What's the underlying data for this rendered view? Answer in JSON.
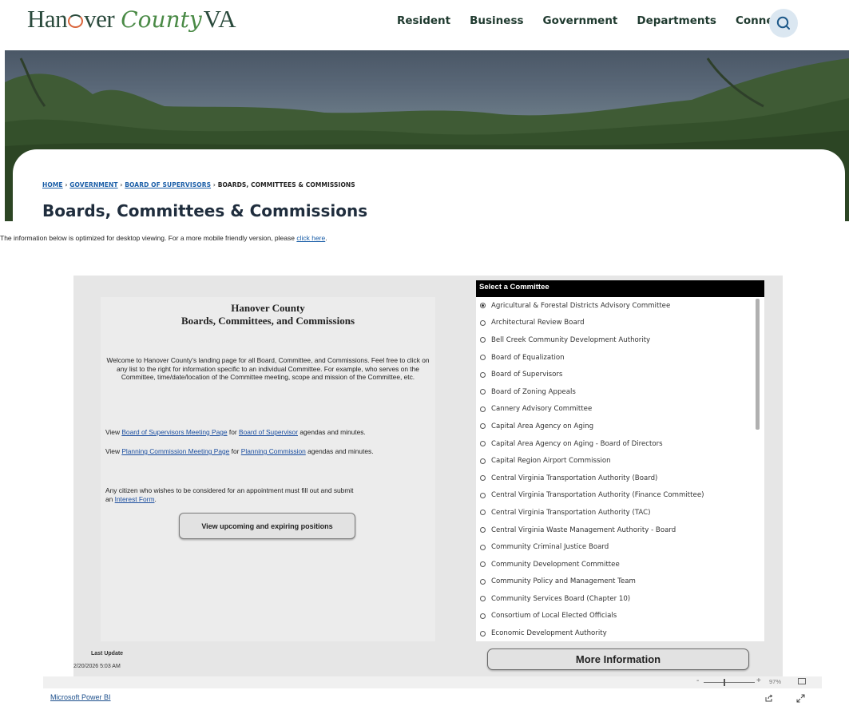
{
  "header": {
    "logo": {
      "part1": "Han",
      "part2": "ver",
      "part3": "County",
      "part4": "VA"
    },
    "nav": [
      "Resident",
      "Business",
      "Government",
      "Departments",
      "Connect"
    ]
  },
  "breadcrumb": {
    "home": "HOME",
    "government": "GOVERNMENT",
    "board": "BOARD OF SUPERVISORS",
    "current": "BOARDS, COMMITTEES & COMMISSIONS",
    "separator": "›"
  },
  "page": {
    "title": "Boards, Committees & Commissions",
    "intro_text": "The information below is optimized for desktop viewing.  For a more mobile friendly version, please ",
    "intro_link": "click here",
    "intro_end": "."
  },
  "report": {
    "left": {
      "title1": "Hanover County",
      "title2": "Boards, Committees, and Commissions",
      "welcome": "Welcome to Hanover County's landing page for all Board, Committee, and Commissions.  Feel free to click on any list to the right for information specific to an individual Committee.  For example, who serves on the Committee, time/date/location of the Committee meeting, scope and mission of the Committee, etc.",
      "bos_view": "View ",
      "bos_link1": "Board of Supervisors Meeting Page",
      "bos_for": " for ",
      "bos_link2": "Board of Supervisor",
      "bos_end": " agendas and minutes.",
      "pc_view": "View ",
      "pc_link1": "Planning Commission Meeting Page",
      "pc_for": " for ",
      "pc_link2": "Planning Commission",
      "pc_end": " agendas and minutes.",
      "apply_text": "Any citizen who wishes to be considered for an appointment must fill out and submit",
      "apply_an": "an ",
      "apply_link": "Interest Form",
      "apply_end": ".",
      "view_button": "View upcoming and expiring positions"
    },
    "last_update_label": "Last Update",
    "last_update_value": "2/20/2026 5:03 AM",
    "selector": {
      "header": "Select a Committee",
      "selected_index": 0,
      "items": [
        "Agricultural & Forestal Districts Advisory Committee",
        "Architectural Review Board",
        "Bell Creek Community Development Authority",
        "Board of Equalization",
        "Board of Supervisors",
        "Board of Zoning Appeals",
        "Cannery Advisory Committee",
        "Capital Area Agency on Aging",
        "Capital Area Agency on Aging - Board of Directors",
        "Capital Region Airport Commission",
        "Central Virginia Transportation Authority (Board)",
        "Central Virginia Transportation Authority (Finance Committee)",
        "Central Virginia Transportation Authority (TAC)",
        "Central Virginia Waste Management Authority - Board",
        "Community Criminal Justice Board",
        "Community Development Committee",
        "Community Policy and Management Team",
        "Community Services Board (Chapter 10)",
        "Consortium of Local Elected Officials",
        "Economic Development Authority"
      ]
    },
    "more_button": "More Information"
  },
  "powerbi": {
    "zoom_minus": "-",
    "zoom_plus": "+",
    "zoom_level": "97%",
    "zoom_fraction": 0.4,
    "link": "Microsoft Power BI"
  },
  "colors": {
    "link": "#1c5fa8",
    "heading": "#1f2d3d",
    "search_bg": "#dbe7f1"
  }
}
